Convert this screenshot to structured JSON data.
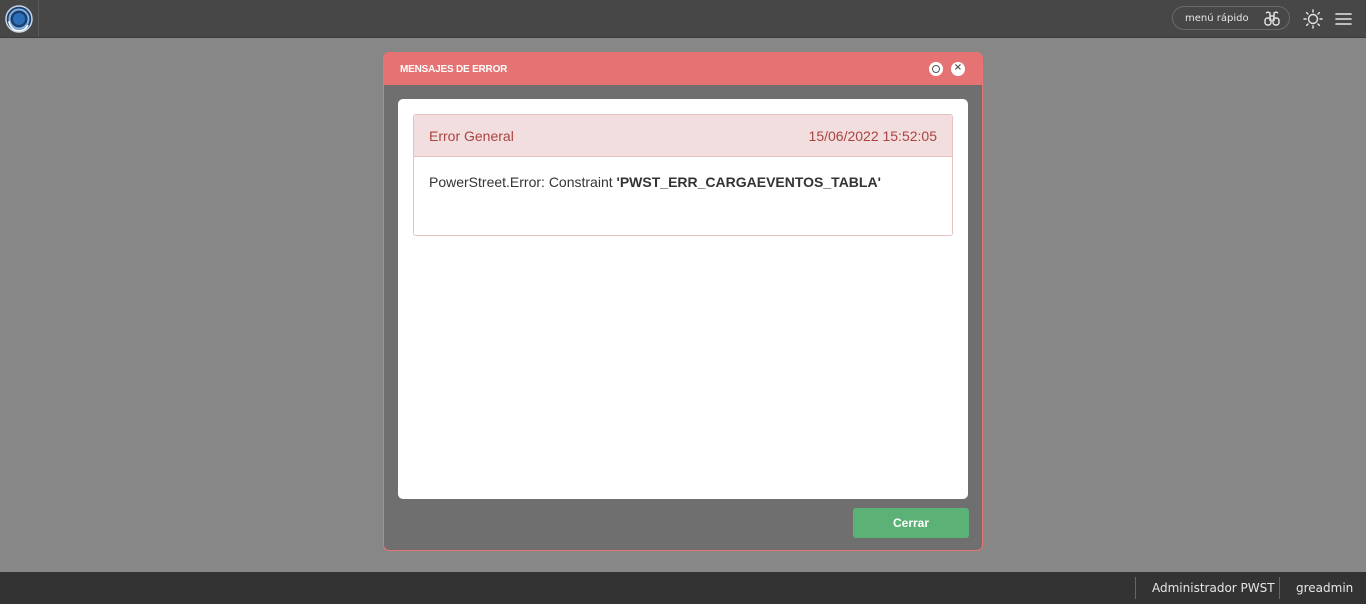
{
  "topbar": {
    "quick_menu_label": "menú rápido",
    "icons": {
      "logo": "app-logo",
      "quick_menu": "binoculars-icon",
      "theme": "sun-icon",
      "menu": "hamburger-menu-icon"
    }
  },
  "modal": {
    "title": "MENSAJES DE ERROR",
    "error": {
      "title": "Error General",
      "timestamp": "15/06/2022 15:52:05",
      "message_prefix": "PowerStreet.Error: Constraint ",
      "message_bold": "'PWST_ERR_CARGAEVENTOS_TABLA'"
    },
    "close_button_label": "Cerrar",
    "colors": {
      "header": "#e57373",
      "error_text": "#a94442",
      "close_button": "#5cb176"
    }
  },
  "footer": {
    "user_role": "Administrador PWST",
    "username": "greadmin"
  }
}
